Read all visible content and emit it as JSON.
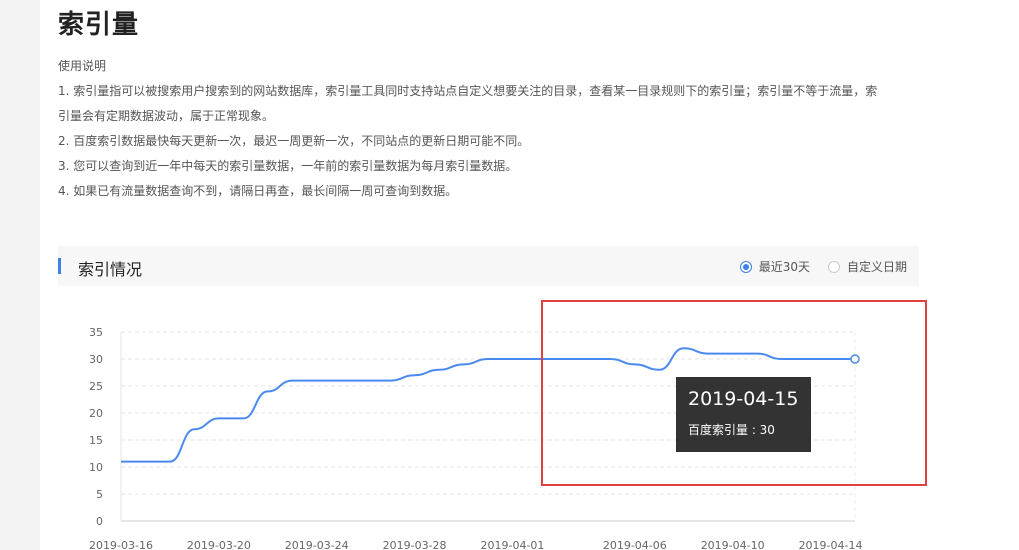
{
  "page": {
    "title": "索引量",
    "instructions_heading": "使用说明",
    "instructions": [
      "1. 索引量指可以被搜索用户搜索到的网站数据库，索引量工具同时支持站点自定义想要关注的目录，查看某一目录规则下的索引量；索引量不等于流量，索",
      "引量会有定期数据波动，属于正常现象。",
      "2. 百度索引数据最快每天更新一次，最迟一周更新一次，不同站点的更新日期可能不同。",
      "3. 您可以查询到近一年中每天的索引量数据，一年前的索引量数据为每月索引量数据。",
      "4. 如果已有流量数据查询不到，请隔日再查，最长间隔一周可查询到数据。"
    ]
  },
  "section": {
    "title": "索引情况",
    "range_options": [
      {
        "label": "最近30天",
        "selected": true
      },
      {
        "label": "自定义日期",
        "selected": false
      }
    ]
  },
  "tooltip": {
    "date": "2019-04-15",
    "value_label": "百度索引量 : 30"
  },
  "colors": {
    "line": "#4a8af0",
    "accent": "#3c82e8",
    "highlight": "#e04040",
    "tooltip_bg": "#282828"
  },
  "chart_data": {
    "type": "line",
    "title": "",
    "xlabel": "",
    "ylabel": "",
    "ylim": [
      0,
      35
    ],
    "yticks": [
      0,
      5,
      10,
      15,
      20,
      25,
      30,
      35
    ],
    "grid": true,
    "x_tick_labels": [
      "2019-03-16",
      "2019-03-20",
      "2019-03-24",
      "2019-03-28",
      "2019-04-01",
      "2019-04-06",
      "2019-04-10",
      "2019-04-14"
    ],
    "series": [
      {
        "x": [
          "2019-03-16",
          "2019-03-17",
          "2019-03-18",
          "2019-03-19",
          "2019-03-20",
          "2019-03-21",
          "2019-03-22",
          "2019-03-23",
          "2019-03-24",
          "2019-03-25",
          "2019-03-26",
          "2019-03-27",
          "2019-03-28",
          "2019-03-29",
          "2019-03-30",
          "2019-03-31",
          "2019-04-01",
          "2019-04-02",
          "2019-04-03",
          "2019-04-04",
          "2019-04-05",
          "2019-04-06",
          "2019-04-07",
          "2019-04-08",
          "2019-04-09",
          "2019-04-10",
          "2019-04-11",
          "2019-04-12",
          "2019-04-13",
          "2019-04-14",
          "2019-04-15"
        ],
        "values": [
          11,
          11,
          11,
          17,
          19,
          19,
          24,
          26,
          26,
          26,
          26,
          26,
          27,
          28,
          29,
          30,
          30,
          30,
          30,
          30,
          30,
          29,
          28,
          32,
          31,
          31,
          31,
          30,
          30,
          30,
          30
        ]
      }
    ]
  }
}
